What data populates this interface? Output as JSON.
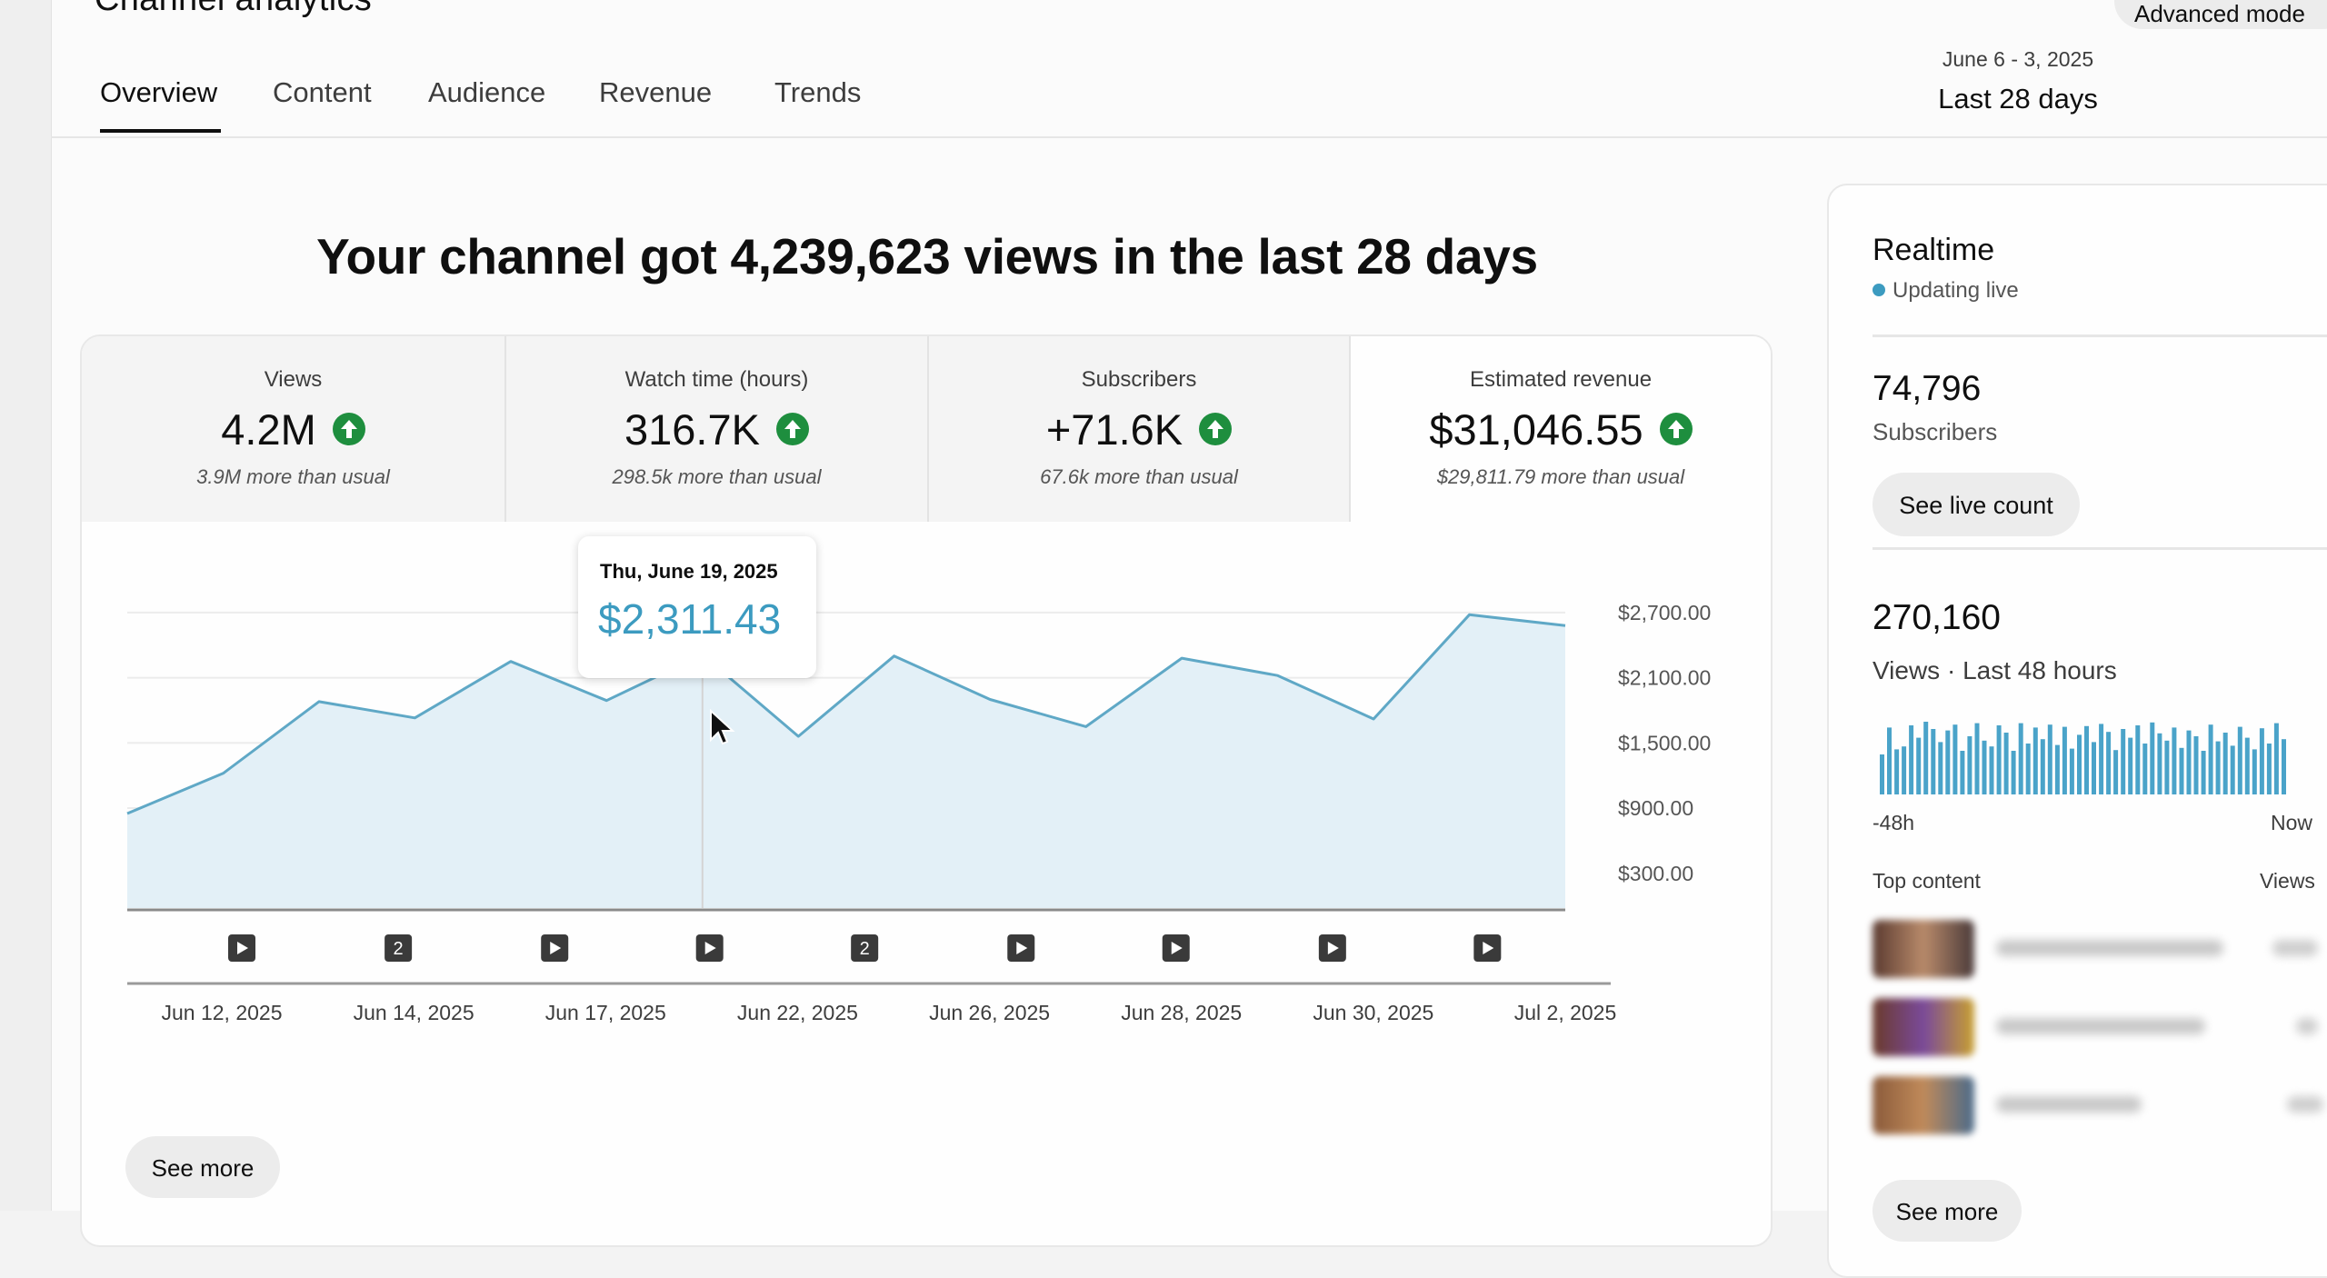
{
  "page_title": "Channel analytics",
  "advanced_mode_label": "Advanced mode",
  "tabs": [
    {
      "label": "Overview",
      "active": true
    },
    {
      "label": "Content",
      "active": false
    },
    {
      "label": "Audience",
      "active": false
    },
    {
      "label": "Revenue",
      "active": false
    },
    {
      "label": "Trends",
      "active": false
    }
  ],
  "date_selector": {
    "range": "June 6 - 3, 2025",
    "label": "Last 28 days"
  },
  "headline": "Your channel got 4,239,623 views in the last 28 days",
  "metrics": [
    {
      "label": "Views",
      "value": "4.2M",
      "note": "3.9M more than usual",
      "trend_icon": "up-arrow-icon",
      "selected": false
    },
    {
      "label": "Watch time (hours)",
      "value": "316.7K",
      "note": "298.5k more than usual",
      "trend_icon": "up-arrow-icon",
      "selected": false
    },
    {
      "label": "Subscribers",
      "value": "+71.6K",
      "note": "67.6k more than usual",
      "trend_icon": "up-arrow-icon",
      "selected": false
    },
    {
      "label": "Estimated revenue",
      "value": "$31,046.55",
      "note": "$29,811.79 more than usual",
      "trend_icon": "up-arrow-icon",
      "selected": true
    }
  ],
  "tooltip": {
    "date": "Thu, June 19, 2025",
    "value": "$2,311.43"
  },
  "chart_data": {
    "type": "area",
    "title": "",
    "xlabel": "",
    "ylabel": "",
    "x_tick_labels": [
      "Jun 12, 2025",
      "Jun 14, 2025",
      "Jun 17, 2025",
      "Jun 22, 2025",
      "Jun 26, 2025",
      "Jun 28, 2025",
      "Jun 30, 2025",
      "Jul 2, 2025"
    ],
    "y_tick_labels": [
      "$2,700.00",
      "$2,100.00",
      "$1,500.00",
      "$900.00",
      "$300.00"
    ],
    "y_ticks": [
      2700,
      2100,
      1500,
      900,
      300
    ],
    "ylim": [
      -20,
      2950
    ],
    "grid": true,
    "series": [
      {
        "values": [
          850,
          1220,
          1880,
          1730,
          2250,
          1890,
          2311.43,
          1560,
          2300,
          1900,
          1650,
          2280,
          2120,
          1720,
          2680,
          2580
        ]
      }
    ],
    "annotation_markers": [
      "play",
      "2",
      "play",
      "play",
      "2",
      "play",
      "play",
      "play",
      "play"
    ],
    "color": "#5fa8c6"
  },
  "see_more_label": "See more",
  "realtime": {
    "title": "Realtime",
    "status": "Updating live",
    "subscribers_value": "74,796",
    "subscribers_label": "Subscribers",
    "live_count_label": "See live count",
    "views_value": "270,160",
    "views_label": "Views · Last 48 hours",
    "bars": [
      0.55,
      0.92,
      0.62,
      0.66,
      0.95,
      0.78,
      1.0,
      0.9,
      0.72,
      0.88,
      0.96,
      0.6,
      0.8,
      0.98,
      0.74,
      0.66,
      0.95,
      0.85,
      0.6,
      0.98,
      0.7,
      0.92,
      0.76,
      0.96,
      0.68,
      0.93,
      0.63,
      0.82,
      0.94,
      0.72,
      0.97,
      0.86,
      0.61,
      0.9,
      0.78,
      0.95,
      0.7,
      0.99,
      0.84,
      0.74,
      0.92,
      0.64,
      0.88,
      0.8,
      0.6,
      0.96,
      0.73,
      0.85,
      0.67,
      0.93,
      0.78,
      0.62,
      0.91,
      0.7,
      0.98,
      0.76
    ],
    "start_label": "-48h",
    "end_label": "Now",
    "top_content_label": "Top content",
    "views_col_label": "Views",
    "see_more_label": "See more"
  }
}
